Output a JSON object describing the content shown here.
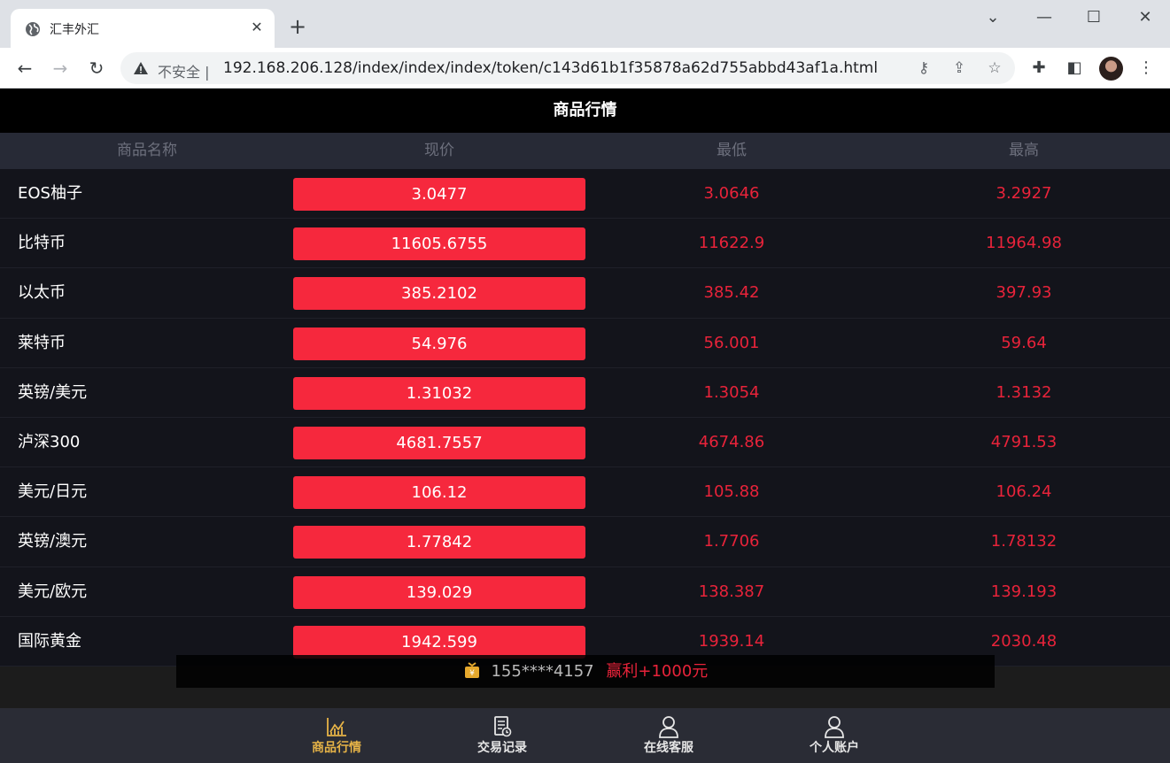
{
  "browser": {
    "tab_title": "汇丰外汇",
    "insecure_label": "不安全",
    "url": "192.168.206.128/index/index/index/token/c143d61b1f35878a62d755abbd43af1a.html"
  },
  "header": {
    "title": "商品行情"
  },
  "columns": {
    "name": "商品名称",
    "price": "现价",
    "low": "最低",
    "high": "最高"
  },
  "rows": [
    {
      "name": "EOS柚子",
      "price": "3.0477",
      "low": "3.0646",
      "high": "3.2927"
    },
    {
      "name": "比特币",
      "price": "11605.6755",
      "low": "11622.9",
      "high": "11964.98"
    },
    {
      "name": "以太币",
      "price": "385.2102",
      "low": "385.42",
      "high": "397.93"
    },
    {
      "name": "莱特币",
      "price": "54.976",
      "low": "56.001",
      "high": "59.64"
    },
    {
      "name": "英镑/美元",
      "price": "1.31032",
      "low": "1.3054",
      "high": "1.3132"
    },
    {
      "name": "泸深300",
      "price": "4681.7557",
      "low": "4674.86",
      "high": "4791.53"
    },
    {
      "name": "美元/日元",
      "price": "106.12",
      "low": "105.88",
      "high": "106.24"
    },
    {
      "name": "英镑/澳元",
      "price": "1.77842",
      "low": "1.7706",
      "high": "1.78132"
    },
    {
      "name": "美元/欧元",
      "price": "139.029",
      "low": "138.387",
      "high": "139.193"
    },
    {
      "name": "国际黄金",
      "price": "1942.599",
      "low": "1939.14",
      "high": "2030.48"
    }
  ],
  "ticker": {
    "phone": "155****4157",
    "profit": "赢利+1000元"
  },
  "nav": [
    {
      "label": "商品行情",
      "icon": "chart-icon",
      "active": true
    },
    {
      "label": "交易记录",
      "icon": "records-icon",
      "active": false
    },
    {
      "label": "在线客服",
      "icon": "user-icon",
      "active": false
    },
    {
      "label": "个人账户",
      "icon": "user-icon",
      "active": false
    }
  ],
  "colors": {
    "accent": "#e6b347",
    "price_bg": "#f6283d",
    "red_text": "#e8233a"
  }
}
